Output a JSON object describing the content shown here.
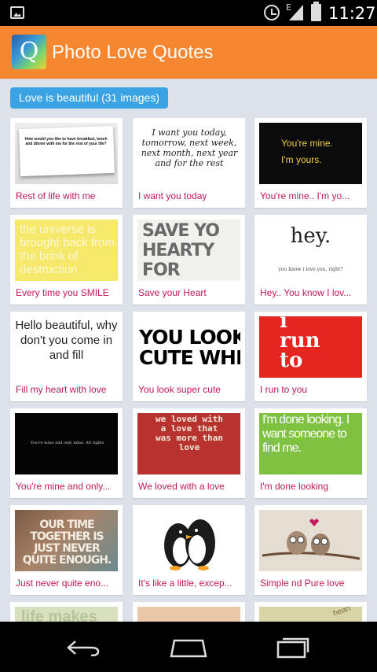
{
  "status_bar": {
    "time": "11:27",
    "network": "E",
    "icons": [
      "image-notification-icon",
      "alarm-icon",
      "signal-icon",
      "battery-icon"
    ]
  },
  "app_bar": {
    "icon_letter": "Q",
    "title": "Photo Love Quotes",
    "color": "#f6862f"
  },
  "category_chip": {
    "label": "Love is beautiful (31 images)",
    "color": "#3aa3e3"
  },
  "items": [
    {
      "caption": "Rest of life with me",
      "thumb_text": "How would you like to have breakfast, lunch and dinner with me for the rest of your life?"
    },
    {
      "caption": "I want you today",
      "thumb_text": "I want you today, tomorrow, next week, next month, next year and for the rest"
    },
    {
      "caption": "You're mine..  I'm yo...",
      "thumb_text": "You're mine. I'm yours."
    },
    {
      "caption": "Every time you SMILE",
      "thumb_text": "the universe is brought back from the brink of destruction"
    },
    {
      "caption": "Save your Heart",
      "thumb_text": "SAVE YO HEARTY FOR SOME("
    },
    {
      "caption": "Hey.. You know I lov...",
      "thumb_text": "hey.",
      "thumb_sub": "you know i love you, right?"
    },
    {
      "caption": "Fill my heart with love",
      "thumb_text": "Hello beautiful, why don't you come in and fill"
    },
    {
      "caption": "You look super cute",
      "thumb_text": "YOU LOOK CUTE WHE"
    },
    {
      "caption": "I run to you",
      "thumb_text": "i run to"
    },
    {
      "caption": "You're mine and only...",
      "thumb_text": "You're mine and only mine. All rights"
    },
    {
      "caption": "We loved with a love",
      "thumb_text": "we loved with a love that was more than love"
    },
    {
      "caption": "I'm done looking",
      "thumb_text": "I'm done looking. I want someone to find me."
    },
    {
      "caption": "Just never quite eno...",
      "thumb_text": "OUR TIME TOGETHER IS JUST NEVER QUITE ENOUGH."
    },
    {
      "caption": "It's like a little, excep...",
      "thumb_text": ""
    },
    {
      "caption": "Simple nd Pure love",
      "thumb_text": ""
    },
    {
      "caption": "",
      "thumb_text": "life makes"
    },
    {
      "caption": "",
      "thumb_text": ""
    },
    {
      "caption": "",
      "thumb_text": "heart"
    }
  ],
  "nav_bar": {
    "buttons": [
      "back-icon",
      "home-icon",
      "recent-apps-icon"
    ]
  }
}
